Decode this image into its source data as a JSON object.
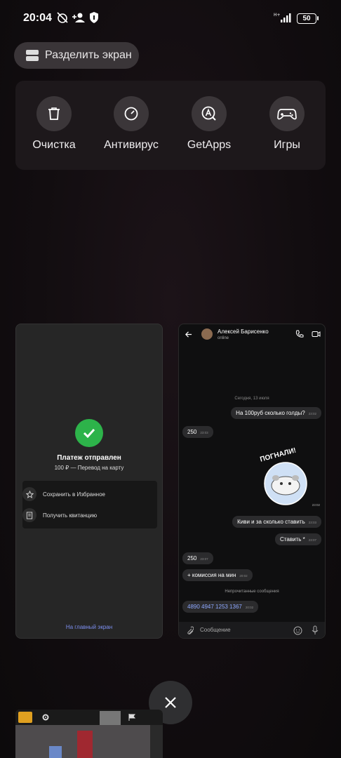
{
  "status_bar": {
    "time": "20:04",
    "battery": "50"
  },
  "split_screen": {
    "label": "Разделить экран"
  },
  "quick_actions": [
    {
      "label": "Очистка",
      "icon": "trash-icon"
    },
    {
      "label": "Антивирус",
      "icon": "speedometer-icon"
    },
    {
      "label": "GetApps",
      "icon": "app-store-icon"
    },
    {
      "label": "Игры",
      "icon": "gamepad-icon"
    }
  ],
  "payment_card": {
    "title": "Платеж отправлен",
    "subtitle": "100 ₽ — Перевод на карту",
    "actions": [
      "Сохранить в Избранное",
      "Получить квитанцию"
    ],
    "home_link": "На главный экран"
  },
  "chat_card": {
    "contact_name": "Алексей Барисенко",
    "contact_status": "online",
    "date": "Сегодня, 13 июля",
    "messages": [
      {
        "text": "На 100руб сколько голды?",
        "time": "23:02"
      },
      {
        "text": "250",
        "time": "23:03"
      },
      {
        "text": "Киви и за сколько ставить",
        "time": "23:03"
      },
      {
        "text": "Ставить *",
        "time": "23:07"
      },
      {
        "text": "250",
        "time": "23:07"
      },
      {
        "text": "+ комиссия на мин",
        "time": "20:02"
      },
      {
        "text": "4890 4947 1253 1367",
        "time": "20:02"
      }
    ],
    "sticker_text": "ПОГНАЛИ!",
    "sticker_time": "23:02",
    "unread_divider": "Непрочитанные сообщения",
    "input_placeholder": "Сообщение"
  }
}
